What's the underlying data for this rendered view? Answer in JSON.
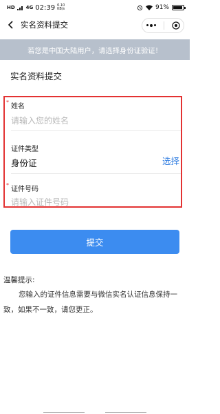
{
  "status_bar": {
    "signal_left": "HD",
    "network": "4G",
    "time": "02:39",
    "speed": "0.10 KB/s",
    "battery": "91%",
    "battery_level": 0.91
  },
  "nav": {
    "title": "实名资料提交"
  },
  "notice": {
    "text": "若您是中国大陆用户，请选择身份证验证！"
  },
  "section": {
    "title": "实名资料提交"
  },
  "form": {
    "name": {
      "required_mark": "*",
      "label": "姓名",
      "placeholder": "请输入您的姓名"
    },
    "id_type": {
      "label": "证件类型",
      "value": "身份证",
      "select_label": "选择"
    },
    "id_number": {
      "required_mark": "*",
      "label": "证件号码",
      "placeholder": "请输入证件号码"
    }
  },
  "submit": {
    "label": "提交"
  },
  "tips": {
    "title": "温馨提示:",
    "body": "您输入的证件信息需要与微信实名认证信息保持一致，如果不一致，请您更正。"
  },
  "colors": {
    "accent": "#3c8cf0",
    "notice_bg": "#b7c0cc",
    "highlight": "#e33232",
    "link": "#2d7be0"
  }
}
